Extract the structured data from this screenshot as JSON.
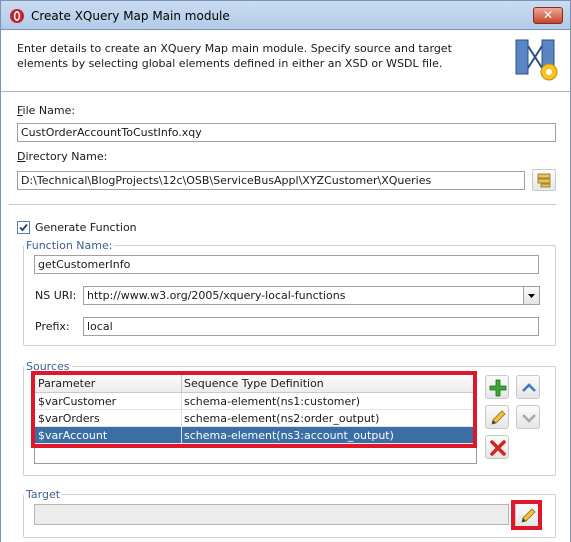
{
  "window": {
    "title": "Create XQuery Map Main module"
  },
  "header": {
    "description": "Enter details to create an XQuery Map main module. Specify source and target elements by selecting global elements defined in either an XSD or WSDL file."
  },
  "file_name": {
    "label_first": "F",
    "label_rest": "ile Name:",
    "value": "CustOrderAccountToCustInfo.xqy"
  },
  "directory_name": {
    "label_first": "D",
    "label_rest": "irectory Name:",
    "value": "D:\\Technical\\BlogProjects\\12c\\OSB\\ServiceBusAppl\\XYZCustomer\\XQueries"
  },
  "generate_function": {
    "label": "Generate Function",
    "checked": true
  },
  "function_group": {
    "title": "Function Name:",
    "function_name": "getCustomerInfo",
    "ns_uri_label": "NS URI:",
    "ns_uri_value": "http://www.w3.org/2005/xquery-local-functions",
    "prefix_label": "Prefix:",
    "prefix_value": "local"
  },
  "sources": {
    "title": "Sources",
    "columns": [
      "Parameter",
      "Sequence Type Definition"
    ],
    "rows": [
      {
        "parameter": "$varCustomer",
        "definition": "schema-element(ns1:customer)"
      },
      {
        "parameter": "$varOrders",
        "definition": "schema-element(ns2:order_output)"
      },
      {
        "parameter": "$varAccount",
        "definition": "schema-element(ns3:account_output)"
      }
    ],
    "selected_row": 2
  },
  "target": {
    "title": "Target",
    "value": ""
  },
  "colors": {
    "highlight": "#e0162b",
    "selection": "#3b6ea5",
    "group_title": "#3f5f8f"
  },
  "icons": [
    "app-logo-icon",
    "close-icon",
    "xquery-map-wizard-icon",
    "browse-folder-icon",
    "checkmark-icon",
    "dropdown-arrow-icon",
    "add-icon",
    "edit-pencil-icon",
    "delete-icon",
    "move-up-icon",
    "move-down-icon"
  ]
}
